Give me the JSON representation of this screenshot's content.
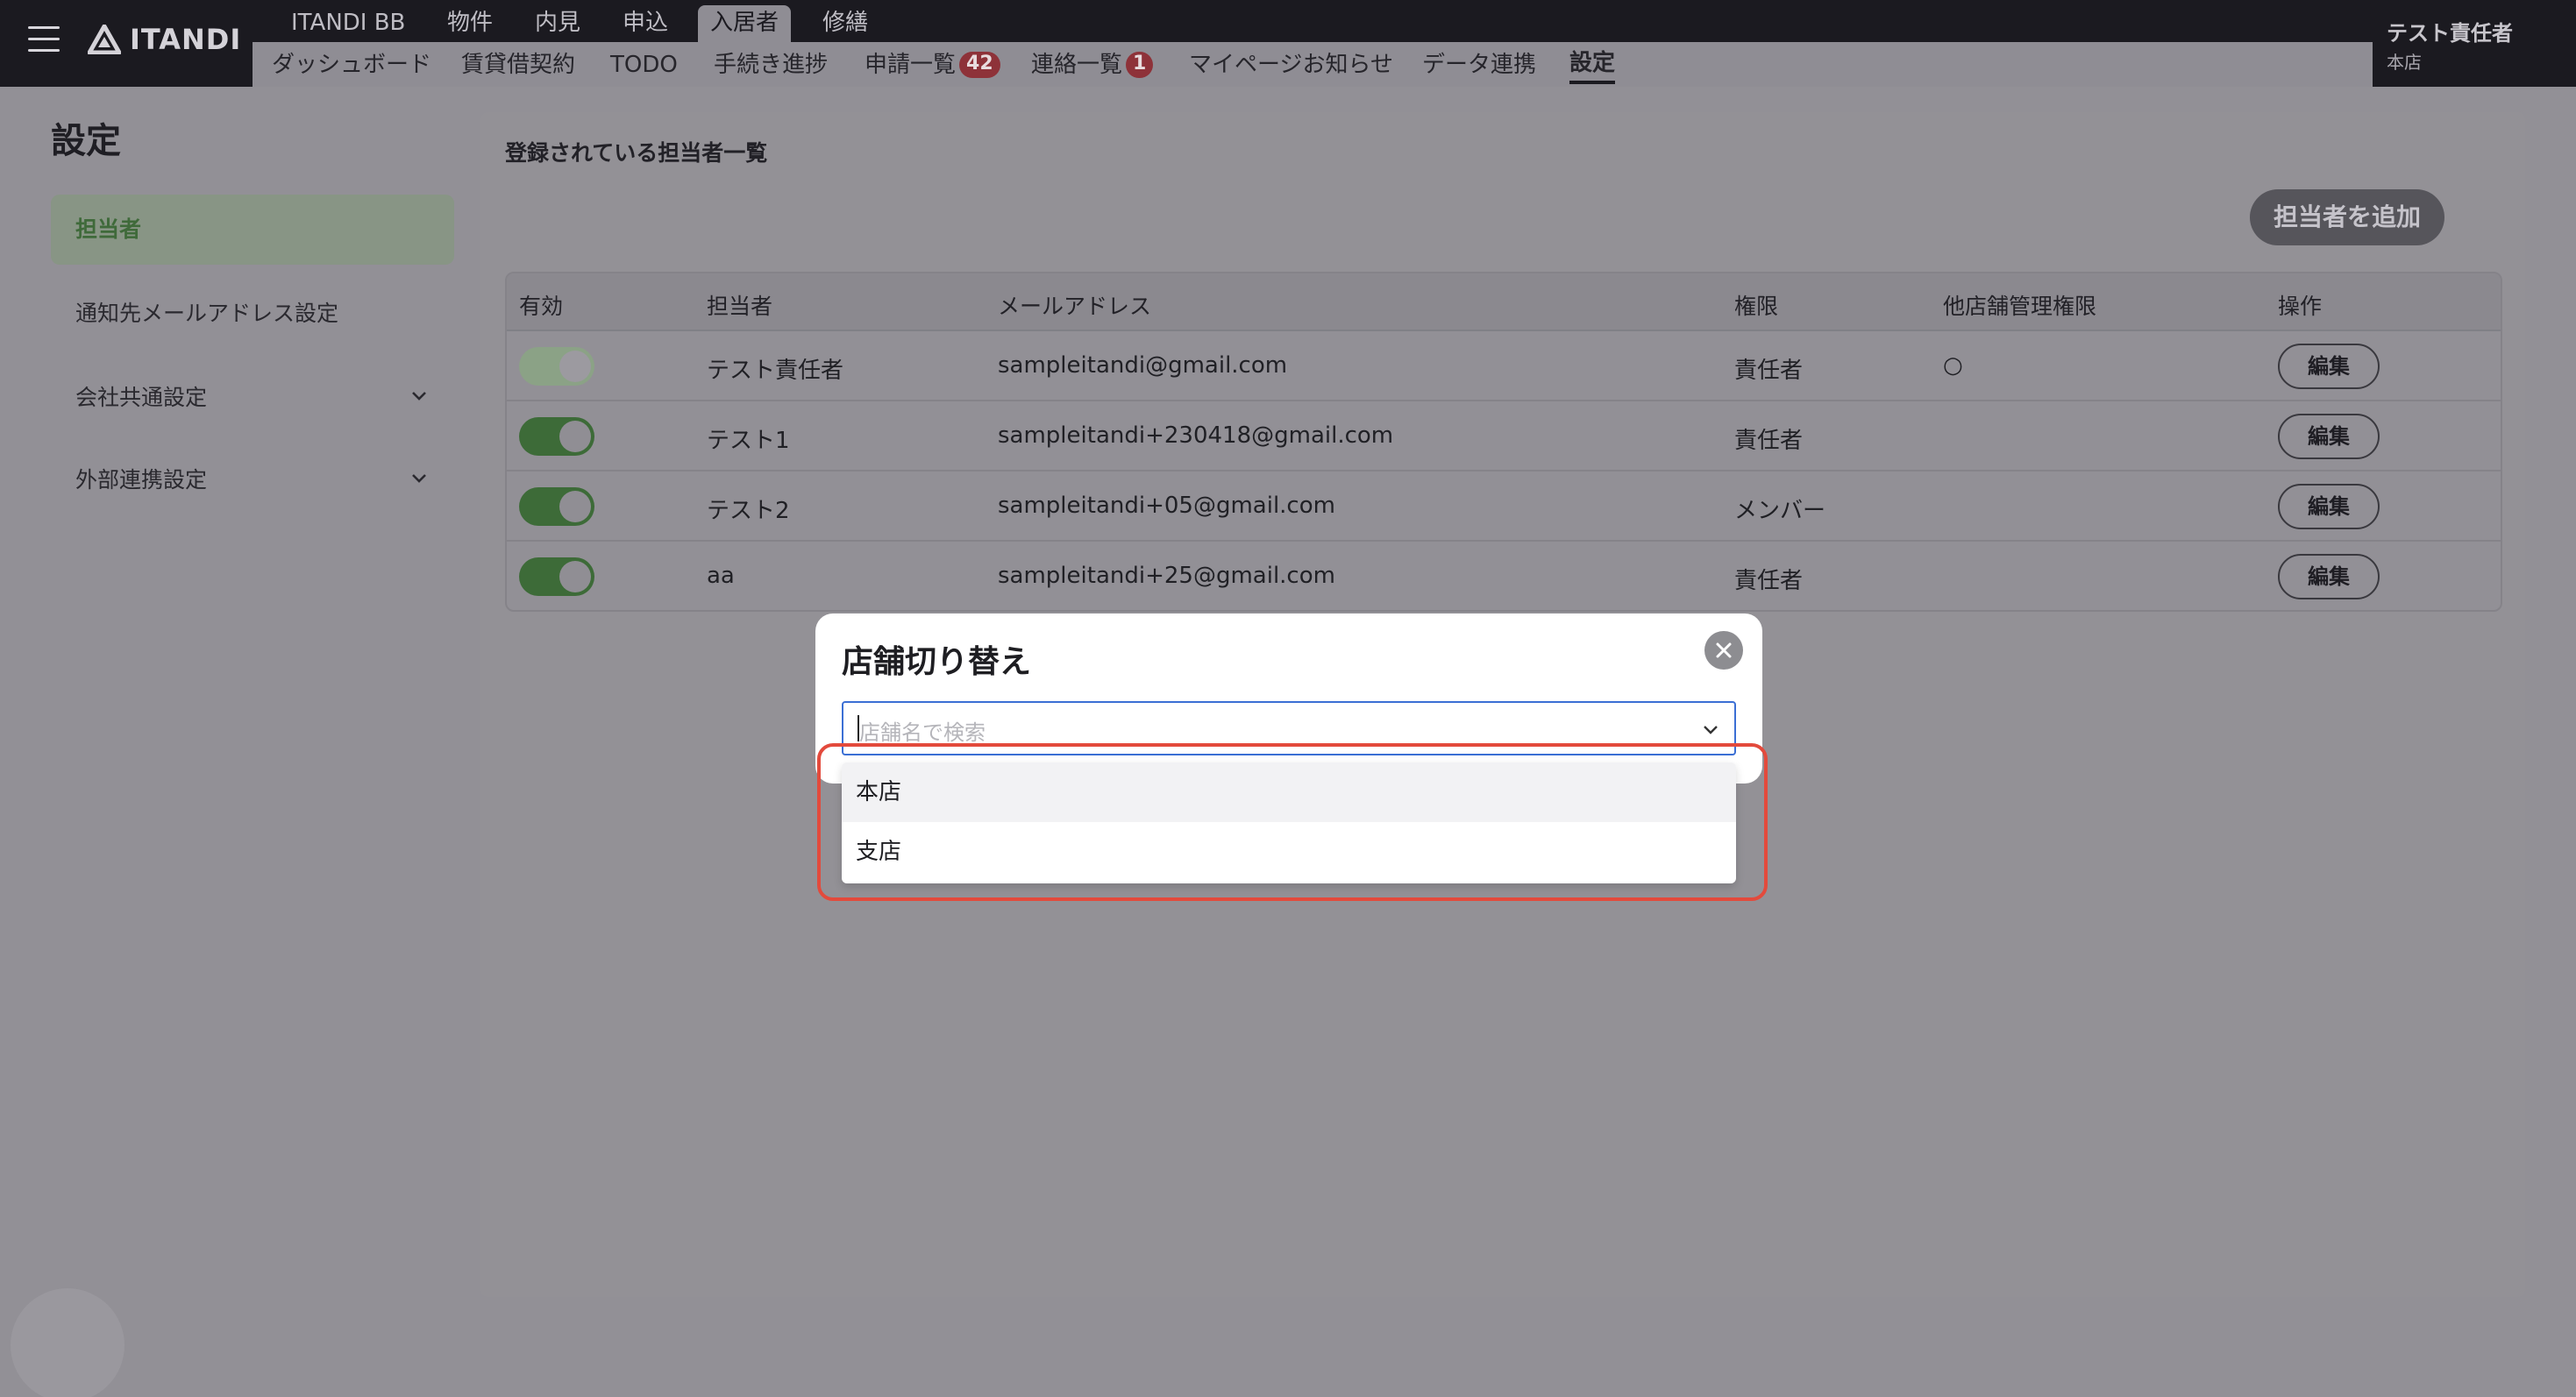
{
  "header": {
    "logo_text": "ITANDI",
    "main_tabs": [
      "ITANDI BB",
      "物件",
      "内見",
      "申込",
      "入居者",
      "修繕"
    ],
    "active_main_tab": "入居者",
    "sub_tabs": [
      "ダッシュボード",
      "賃貸借契約",
      "TODO",
      "手続き進捗",
      "申請一覧",
      "連絡一覧",
      "マイページお知らせ",
      "データ連携",
      "設定"
    ],
    "sub_tab_badges": {
      "申請一覧": "42",
      "連絡一覧": "1"
    },
    "active_sub_tab": "設定",
    "user": {
      "name": "テスト責任者",
      "store": "本店"
    }
  },
  "sidebar": {
    "title": "設定",
    "items": [
      {
        "label": "担当者",
        "active": true
      },
      {
        "label": "通知先メールアドレス設定"
      },
      {
        "label": "会社共通設定",
        "expandable": true
      },
      {
        "label": "外部連携設定",
        "expandable": true
      }
    ]
  },
  "main": {
    "section_title": "登録されている担当者一覧",
    "add_button": "担当者を追加",
    "columns": [
      "有効",
      "担当者",
      "メールアドレス",
      "権限",
      "他店舗管理権限",
      "操作"
    ],
    "rows": [
      {
        "enabled": true,
        "disabled_toggle": true,
        "name": "テスト責任者",
        "email": "sampleitandi@gmail.com",
        "role": "責任者",
        "other_store": "○",
        "action": "編集"
      },
      {
        "enabled": true,
        "name": "テスト1",
        "email": "sampleitandi+230418@gmail.com",
        "role": "責任者",
        "other_store": "",
        "action": "編集"
      },
      {
        "enabled": true,
        "name": "テスト2",
        "email": "sampleitandi+05@gmail.com",
        "role": "メンバー",
        "other_store": "",
        "action": "編集"
      },
      {
        "enabled": true,
        "name": "aa",
        "email": "sampleitandi+25@gmail.com",
        "role": "責任者",
        "other_store": "",
        "action": "編集"
      }
    ]
  },
  "modal": {
    "title": "店舗切り替え",
    "search_placeholder": "店舗名で検索",
    "options": [
      "本店",
      "支店"
    ]
  },
  "colors": {
    "accent_green": "#3d6b38",
    "badge_red": "#8e3239",
    "highlight_red": "#e34a3c",
    "focus_blue": "#3b6fd4"
  }
}
